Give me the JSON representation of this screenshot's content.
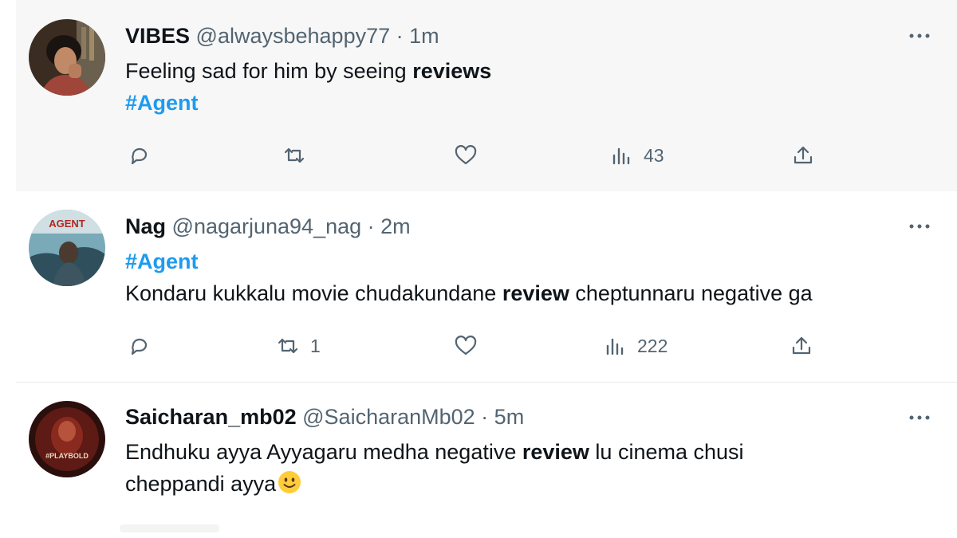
{
  "tweets": [
    {
      "display_name": "VIBES",
      "handle": "@alwaysbehappy77",
      "time": "1m",
      "text_line1_pre": "Feeling sad for him by seeing ",
      "text_line1_bold": "reviews",
      "hashtag": "#Agent",
      "reply_count": "",
      "retweet_count": "",
      "like_count": "",
      "view_count": "43"
    },
    {
      "display_name": "Nag",
      "handle": "@nagarjuna94_nag",
      "time": "2m",
      "hashtag": "#Agent",
      "text_line2_pre": "Kondaru kukkalu movie chudakundane ",
      "text_line2_bold": "review",
      "text_line2_post": " cheptunnaru negative ga",
      "avatar_text": "AGENT",
      "reply_count": "",
      "retweet_count": "1",
      "like_count": "",
      "view_count": "222"
    },
    {
      "display_name": "Saicharan_mb02",
      "handle": "@SaicharanMb02",
      "time": "5m",
      "text_line1_pre": "Endhuku ayya Ayyagaru medha negative ",
      "text_line1_bold": "review",
      "text_line1_post": " lu cinema chusi",
      "text_line2": "cheppandi ayya",
      "emoji": "slightly-smiling-face",
      "avatar_text": "#PLAYBOLD"
    }
  ],
  "separator": " · ",
  "icons": [
    "reply-icon",
    "retweet-icon",
    "like-icon",
    "views-icon",
    "share-icon",
    "more-icon"
  ],
  "colors": {
    "hashtag": "#1d9bf0",
    "muted": "#536471",
    "text": "#0f1419",
    "highlight_bg": "#f7f7f7"
  }
}
